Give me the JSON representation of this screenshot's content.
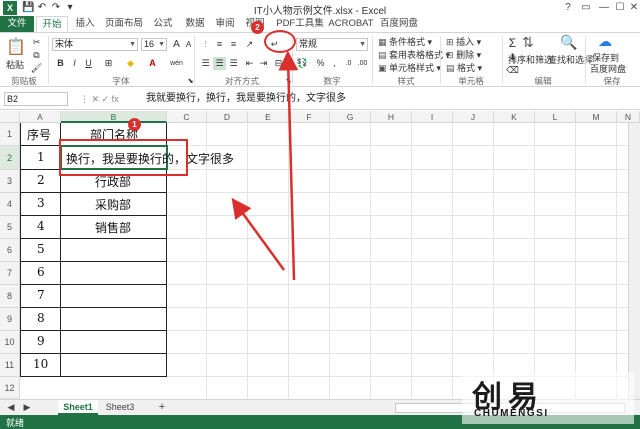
{
  "window": {
    "title": "IT小人物示例文件.xlsx - Excel",
    "app_icon": "X",
    "controls": {
      "help": "?",
      "restore": "▭",
      "minimize": "—",
      "maximize": "☐",
      "close": "✕"
    }
  },
  "tabs": [
    {
      "label": "文件"
    },
    {
      "label": "开始"
    },
    {
      "label": "插入"
    },
    {
      "label": "页面布局"
    },
    {
      "label": "公式"
    },
    {
      "label": "数据"
    },
    {
      "label": "审阅"
    },
    {
      "label": "视图"
    },
    {
      "label": "PDF工具集"
    },
    {
      "label": "ACROBAT"
    },
    {
      "label": "百度网盘"
    }
  ],
  "ribbon": {
    "clipboard": {
      "paste": "粘贴",
      "label": "剪贴板"
    },
    "font": {
      "name": "宋体",
      "size": "16",
      "bold": "B",
      "italic": "I",
      "underline": "U",
      "grow": "A",
      "shrink": "A",
      "label": "字体",
      "wen": "wén"
    },
    "alignment": {
      "label": "对齐方式"
    },
    "number": {
      "format": "常规",
      "percent": "%",
      "comma": ",",
      "label": "数字"
    },
    "styles": {
      "conditional": "条件格式",
      "table": "套用表格格式",
      "cell_styles": "单元格样式",
      "label": "样式"
    },
    "cells": {
      "insert": "插入",
      "delete": "删除",
      "format": "格式",
      "label": "单元格"
    },
    "editing": {
      "sum": "Σ",
      "sort_filter": "排序和筛选",
      "find_select": "查找和选择",
      "label": "编辑"
    },
    "save": {
      "label1": "保存到",
      "label2": "百度网盘",
      "group_label": "保存"
    }
  },
  "formula_bar": {
    "name_box": "B2",
    "icons": "⋮  ✕  ✓  fx",
    "content": "我就要换行，换行，我是要换行的，文字很多"
  },
  "columns": [
    "A",
    "B",
    "C",
    "D",
    "E",
    "F",
    "G",
    "H",
    "I",
    "J",
    "K",
    "L",
    "M",
    "N"
  ],
  "rows": [
    "1",
    "2",
    "3",
    "4",
    "5",
    "6",
    "7",
    "8",
    "9",
    "10",
    "11",
    "12"
  ],
  "cells": {
    "a1": "序号",
    "b1": "部门名称",
    "a2": "1",
    "b2": "换行，我是要换行的，文字很多",
    "a3": "2",
    "b3": "行政部",
    "a4": "3",
    "b4": "采购部",
    "a5": "4",
    "b5": "销售部",
    "a6": "5",
    "a7": "6",
    "a8": "7",
    "a9": "8",
    "a10": "9",
    "a11": "10"
  },
  "sheets": [
    {
      "label": "Sheet1"
    },
    {
      "label": "Sheet3"
    }
  ],
  "add_sheet": "+",
  "status": "就绪",
  "badges": {
    "b1": "1",
    "b2": "2"
  },
  "watermark": {
    "cn": "创易",
    "en": "CHUMENGSI"
  },
  "colors": {
    "accent": "#217346",
    "annotation": "#d9302e"
  }
}
